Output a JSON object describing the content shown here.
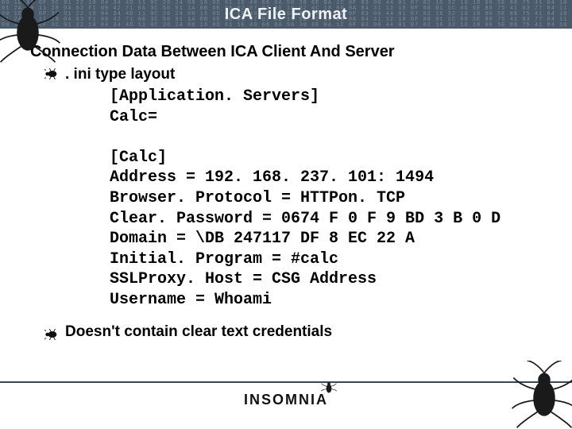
{
  "slide": {
    "title": "ICA File Format",
    "heading": "Connection Data Between ICA Client And Server",
    "sub_bullet": ". ini type layout",
    "code_lines": [
      "[Application. Servers]",
      "Calc=",
      "",
      "[Calc]",
      "Address = 192. 168. 237. 101: 1494",
      "Browser. Protocol = HTTPon. TCP",
      "Clear. Password = 0674 F 0 F 9 BD 3 B 0 D",
      "Domain = \\DB 247117 DF 8 EC 22 A",
      "Initial. Program = #calc",
      "SSLProxy. Host = CSG Address",
      "Username = Whoami"
    ],
    "note": "Doesn't contain clear text credentials",
    "footer_brand": "INSOMNIA"
  }
}
